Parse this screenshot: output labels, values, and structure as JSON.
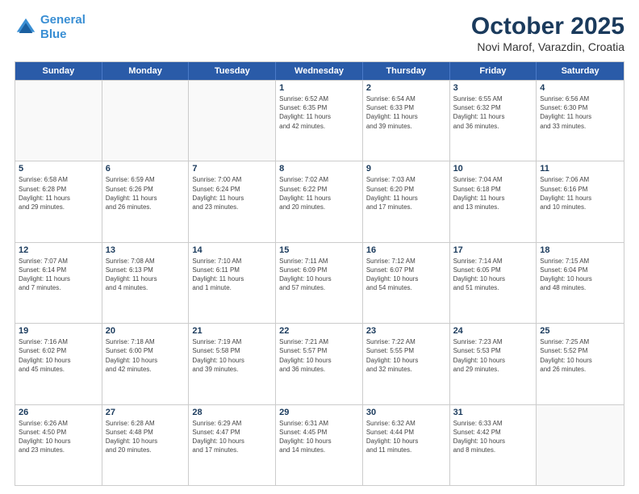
{
  "header": {
    "logo_line1": "General",
    "logo_line2": "Blue",
    "month": "October 2025",
    "location": "Novi Marof, Varazdin, Croatia"
  },
  "weekdays": [
    "Sunday",
    "Monday",
    "Tuesday",
    "Wednesday",
    "Thursday",
    "Friday",
    "Saturday"
  ],
  "rows": [
    [
      {
        "day": "",
        "info": ""
      },
      {
        "day": "",
        "info": ""
      },
      {
        "day": "",
        "info": ""
      },
      {
        "day": "1",
        "info": "Sunrise: 6:52 AM\nSunset: 6:35 PM\nDaylight: 11 hours\nand 42 minutes."
      },
      {
        "day": "2",
        "info": "Sunrise: 6:54 AM\nSunset: 6:33 PM\nDaylight: 11 hours\nand 39 minutes."
      },
      {
        "day": "3",
        "info": "Sunrise: 6:55 AM\nSunset: 6:32 PM\nDaylight: 11 hours\nand 36 minutes."
      },
      {
        "day": "4",
        "info": "Sunrise: 6:56 AM\nSunset: 6:30 PM\nDaylight: 11 hours\nand 33 minutes."
      }
    ],
    [
      {
        "day": "5",
        "info": "Sunrise: 6:58 AM\nSunset: 6:28 PM\nDaylight: 11 hours\nand 29 minutes."
      },
      {
        "day": "6",
        "info": "Sunrise: 6:59 AM\nSunset: 6:26 PM\nDaylight: 11 hours\nand 26 minutes."
      },
      {
        "day": "7",
        "info": "Sunrise: 7:00 AM\nSunset: 6:24 PM\nDaylight: 11 hours\nand 23 minutes."
      },
      {
        "day": "8",
        "info": "Sunrise: 7:02 AM\nSunset: 6:22 PM\nDaylight: 11 hours\nand 20 minutes."
      },
      {
        "day": "9",
        "info": "Sunrise: 7:03 AM\nSunset: 6:20 PM\nDaylight: 11 hours\nand 17 minutes."
      },
      {
        "day": "10",
        "info": "Sunrise: 7:04 AM\nSunset: 6:18 PM\nDaylight: 11 hours\nand 13 minutes."
      },
      {
        "day": "11",
        "info": "Sunrise: 7:06 AM\nSunset: 6:16 PM\nDaylight: 11 hours\nand 10 minutes."
      }
    ],
    [
      {
        "day": "12",
        "info": "Sunrise: 7:07 AM\nSunset: 6:14 PM\nDaylight: 11 hours\nand 7 minutes."
      },
      {
        "day": "13",
        "info": "Sunrise: 7:08 AM\nSunset: 6:13 PM\nDaylight: 11 hours\nand 4 minutes."
      },
      {
        "day": "14",
        "info": "Sunrise: 7:10 AM\nSunset: 6:11 PM\nDaylight: 11 hours\nand 1 minute."
      },
      {
        "day": "15",
        "info": "Sunrise: 7:11 AM\nSunset: 6:09 PM\nDaylight: 10 hours\nand 57 minutes."
      },
      {
        "day": "16",
        "info": "Sunrise: 7:12 AM\nSunset: 6:07 PM\nDaylight: 10 hours\nand 54 minutes."
      },
      {
        "day": "17",
        "info": "Sunrise: 7:14 AM\nSunset: 6:05 PM\nDaylight: 10 hours\nand 51 minutes."
      },
      {
        "day": "18",
        "info": "Sunrise: 7:15 AM\nSunset: 6:04 PM\nDaylight: 10 hours\nand 48 minutes."
      }
    ],
    [
      {
        "day": "19",
        "info": "Sunrise: 7:16 AM\nSunset: 6:02 PM\nDaylight: 10 hours\nand 45 minutes."
      },
      {
        "day": "20",
        "info": "Sunrise: 7:18 AM\nSunset: 6:00 PM\nDaylight: 10 hours\nand 42 minutes."
      },
      {
        "day": "21",
        "info": "Sunrise: 7:19 AM\nSunset: 5:58 PM\nDaylight: 10 hours\nand 39 minutes."
      },
      {
        "day": "22",
        "info": "Sunrise: 7:21 AM\nSunset: 5:57 PM\nDaylight: 10 hours\nand 36 minutes."
      },
      {
        "day": "23",
        "info": "Sunrise: 7:22 AM\nSunset: 5:55 PM\nDaylight: 10 hours\nand 32 minutes."
      },
      {
        "day": "24",
        "info": "Sunrise: 7:23 AM\nSunset: 5:53 PM\nDaylight: 10 hours\nand 29 minutes."
      },
      {
        "day": "25",
        "info": "Sunrise: 7:25 AM\nSunset: 5:52 PM\nDaylight: 10 hours\nand 26 minutes."
      }
    ],
    [
      {
        "day": "26",
        "info": "Sunrise: 6:26 AM\nSunset: 4:50 PM\nDaylight: 10 hours\nand 23 minutes."
      },
      {
        "day": "27",
        "info": "Sunrise: 6:28 AM\nSunset: 4:48 PM\nDaylight: 10 hours\nand 20 minutes."
      },
      {
        "day": "28",
        "info": "Sunrise: 6:29 AM\nSunset: 4:47 PM\nDaylight: 10 hours\nand 17 minutes."
      },
      {
        "day": "29",
        "info": "Sunrise: 6:31 AM\nSunset: 4:45 PM\nDaylight: 10 hours\nand 14 minutes."
      },
      {
        "day": "30",
        "info": "Sunrise: 6:32 AM\nSunset: 4:44 PM\nDaylight: 10 hours\nand 11 minutes."
      },
      {
        "day": "31",
        "info": "Sunrise: 6:33 AM\nSunset: 4:42 PM\nDaylight: 10 hours\nand 8 minutes."
      },
      {
        "day": "",
        "info": ""
      }
    ]
  ]
}
